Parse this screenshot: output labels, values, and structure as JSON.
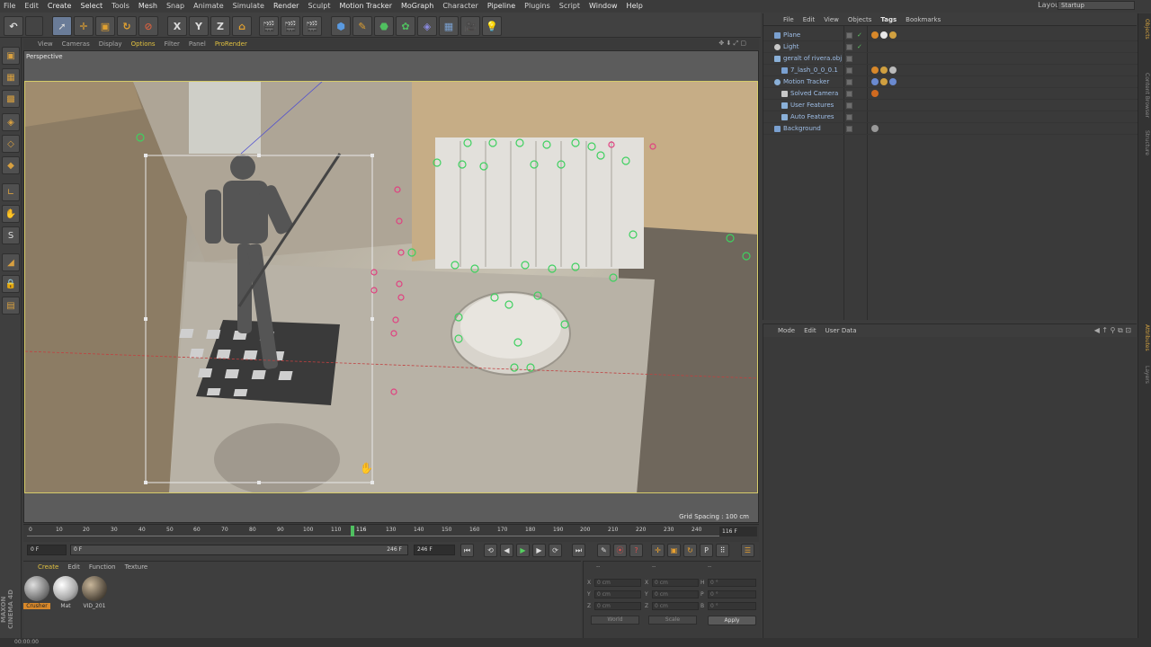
{
  "menubar": {
    "items": [
      "File",
      "Edit",
      "Create",
      "Select",
      "Tools",
      "Mesh",
      "Snap",
      "Animate",
      "Simulate",
      "Render",
      "Sculpt",
      "Motion Tracker",
      "MoGraph",
      "Character",
      "Pipeline",
      "Plugins",
      "Script",
      "Window",
      "Help"
    ],
    "layout_label": "Layout:",
    "layout_value": "Startup"
  },
  "toolbar": {
    "axis_x": "X",
    "axis_y": "Y",
    "axis_z": "Z"
  },
  "viewport": {
    "menu": [
      "View",
      "Cameras",
      "Display",
      "Options",
      "Filter",
      "Panel",
      "ProRender"
    ],
    "label": "Perspective",
    "grid_spacing": "Grid Spacing : 100 cm"
  },
  "timeline": {
    "ticks": [
      "0",
      "10",
      "20",
      "30",
      "40",
      "50",
      "60",
      "70",
      "80",
      "90",
      "100",
      "110",
      "116",
      "130",
      "140",
      "150",
      "160",
      "170",
      "180",
      "190",
      "200",
      "210",
      "220",
      "230",
      "240"
    ],
    "current_frame": 116,
    "end_frame_display": "116 F"
  },
  "transport": {
    "start_field": "0 F",
    "range_start": "0 F",
    "range_end": "246 F",
    "end_field": "246 F"
  },
  "material_panel": {
    "menu": [
      "Create",
      "Edit",
      "Function",
      "Texture"
    ],
    "materials": [
      {
        "label": "Crusher",
        "selected": true
      },
      {
        "label": "Mat",
        "selected": false
      },
      {
        "label": "VID_201",
        "selected": false
      }
    ]
  },
  "coord_panel": {
    "headers": [
      "--",
      "--",
      "--"
    ],
    "rows": [
      {
        "a": "X",
        "a_val": "0 cm",
        "b": "X",
        "b_val": "0 cm",
        "c": "H",
        "c_val": "0 °"
      },
      {
        "a": "Y",
        "a_val": "0 cm",
        "b": "Y",
        "b_val": "0 cm",
        "c": "P",
        "c_val": "0 °"
      },
      {
        "a": "Z",
        "a_val": "0 cm",
        "b": "Z",
        "b_val": "0 cm",
        "c": "B",
        "c_val": "0 °"
      }
    ],
    "mode1": "World",
    "mode2": "Scale",
    "apply_label": "Apply"
  },
  "side_brand": "MAXON CINEMA 4D",
  "status_bar": "00:00:00",
  "object_manager": {
    "menu": [
      "File",
      "Edit",
      "View",
      "Objects",
      "Tags",
      "Bookmarks"
    ],
    "objects": [
      {
        "name": "Plane",
        "indent": 0,
        "color": "#7aa0d0"
      },
      {
        "name": "Light",
        "indent": 0,
        "color": "#c8c8c8"
      },
      {
        "name": "geralt of rivera.obj",
        "indent": 0,
        "color": "#8ab0d8"
      },
      {
        "name": "7_lash_0_0_0.1",
        "indent": 1,
        "color": "#7aa0d0"
      },
      {
        "name": "Motion Tracker",
        "indent": 0,
        "color": "#8ab0d8"
      },
      {
        "name": "Solved Camera",
        "indent": 1,
        "color": "#c8c8c8"
      },
      {
        "name": "User Features",
        "indent": 1,
        "color": "#8ab0d8"
      },
      {
        "name": "Auto Features",
        "indent": 1,
        "color": "#8ab0d8"
      },
      {
        "name": "Background",
        "indent": 0,
        "color": "#7aa0d0"
      }
    ]
  },
  "attribute_manager": {
    "menu": [
      "Mode",
      "Edit",
      "User Data"
    ]
  },
  "side_tabs": [
    "Objects",
    "Content Browser",
    "Structure",
    "Attributes",
    "Layers"
  ],
  "colors": {
    "accent_yellow": "#e0c040",
    "selection_orange": "#d8882a",
    "play_green": "#55d060",
    "record_red": "#e05050",
    "object_blue": "#9fbfe8"
  }
}
